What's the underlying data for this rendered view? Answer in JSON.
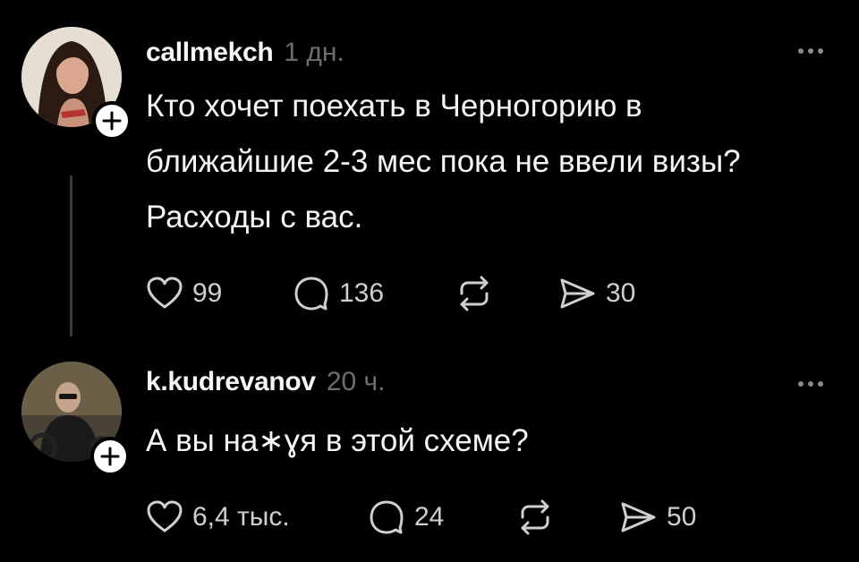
{
  "posts": [
    {
      "username": "callmekch",
      "timestamp": "1 дн.",
      "text_lines": [
        "Кто хочет поехать в Черногорию в",
        "ближайшие 2-3 мес пока не ввели визы?",
        "Расходы с вас."
      ],
      "likes": "99",
      "comments": "136",
      "shares": "30",
      "avatar_icon": "profile-photo-woman",
      "follow_icon": "plus-icon"
    },
    {
      "username": "k.kudrevanov",
      "timestamp": "20 ч.",
      "text_lines": [
        "А вы на∗ɣя в этой схеме?"
      ],
      "likes": "6,4 тыс.",
      "comments": "24",
      "shares": "50",
      "avatar_icon": "profile-photo-man-motorcycle",
      "follow_icon": "plus-icon"
    }
  ],
  "icons": {
    "like": "heart-icon",
    "comment": "speech-bubble-icon",
    "repost": "repost-icon",
    "share": "send-icon",
    "more": "more-dots-icon"
  },
  "colors": {
    "background": "#000000",
    "text": "#f3f5f7",
    "secondary": "#6e6e6e",
    "thread_line": "#3b3b3b"
  }
}
